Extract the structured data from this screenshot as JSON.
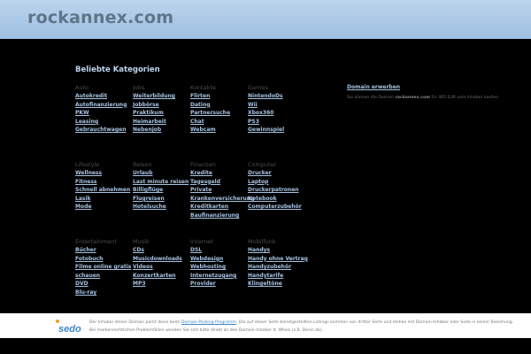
{
  "header": {
    "title": "rockannex.com"
  },
  "main": {
    "heading": "Beliebte Kategorien",
    "columns": [
      {
        "title": "Auto",
        "items": [
          "Autokredit",
          "Autofinanzierung",
          "PKW",
          "Leasing",
          "Gebrauchtwagen"
        ]
      },
      {
        "title": "Jobs",
        "items": [
          "Weiterbildung",
          "Jobbörse",
          "Praktikum",
          "Heimarbeit",
          "Nebenjob"
        ]
      },
      {
        "title": "Kontakte",
        "items": [
          "Flirten",
          "Dating",
          "Partnersuche",
          "Chat",
          "Webcam"
        ]
      },
      {
        "title": "Games",
        "items": [
          "NintendoDs",
          "Wii",
          "Xbox360",
          "PS3",
          "Gewinnspiel"
        ]
      },
      {
        "title": "Lifestyle",
        "items": [
          "Wellness",
          "Fitness",
          "Schnell abnehmen",
          "Lasik",
          "Mode"
        ]
      },
      {
        "title": "Reisen",
        "items": [
          "Urlaub",
          "Last minute reisen",
          "Billigflüge",
          "Flugreisen",
          "Hotelsuche"
        ]
      },
      {
        "title": "Finanzen",
        "items": [
          "Kredite",
          "Tagesgeld",
          "Private",
          "Krankenversicherung",
          "Kreditkarten",
          "Baufinanzierung"
        ]
      },
      {
        "title": "Computer",
        "items": [
          "Drucker",
          "Laptop",
          "Druckerpatronen",
          "Notebook",
          "Computerzubehör"
        ]
      },
      {
        "title": "Entertainment",
        "items": [
          "Bücher",
          "Fotobuch",
          "Filme online gratis",
          "schauen",
          "DVD",
          "Blu-ray"
        ]
      },
      {
        "title": "Musik",
        "items": [
          "CDs",
          "Musicdownloads",
          "Videos",
          "Konzertkarten",
          "MP3"
        ]
      },
      {
        "title": "Internet",
        "items": [
          "DSL",
          "Webdesign",
          "Webhosting",
          "Internetzugang",
          "Provider"
        ]
      },
      {
        "title": "Mobilfunk",
        "items": [
          "Handys",
          "Handy ohne Vertrag",
          "Handyzubehör",
          "Handytarife",
          "Klingeltöne"
        ]
      }
    ]
  },
  "sidebar": {
    "link": "Domain erwerben",
    "text_pre": "Sie können die Domain ",
    "text_domain": "rockannex.com",
    "text_post": " für 465 EUR vom Inhaber kaufen."
  },
  "footer": {
    "logo": "sedo",
    "line1_pre": "Der Inhaber dieser Domain parkt diese beim ",
    "line1_link": "Domain-Parking-Programm",
    "line1_post": ". Die auf dieser Seite bereitgestellten Listings kommen von dritter Seite und stehen mit Domain-Inhaber oder Sedo in keiner Beziehung.",
    "line2": "Bei markenrechtlichen Problemfällen wenden Sie sich bitte direkt an den Domain-Inhaber lt. Whois (z.B. Denic.de)."
  }
}
